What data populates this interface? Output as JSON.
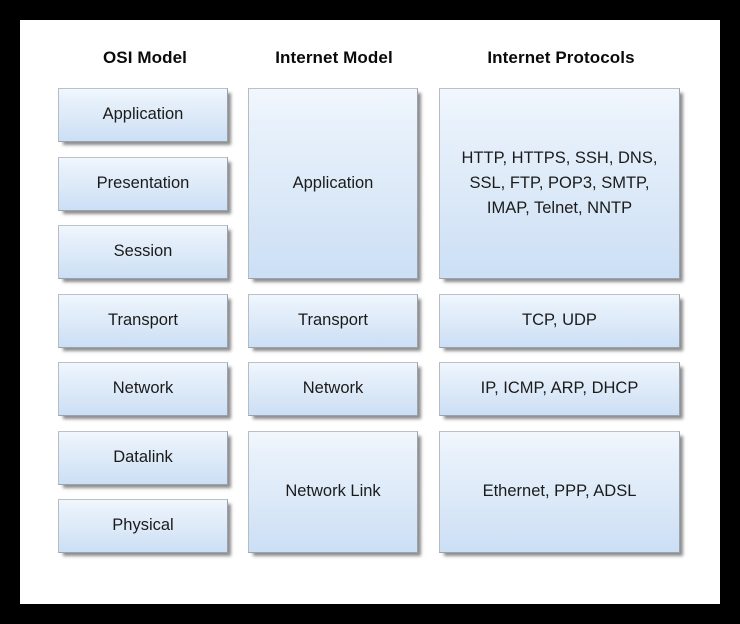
{
  "diagram": {
    "title_row": {
      "osi": "OSI Model",
      "internet": "Internet Model",
      "protocols": "Internet Protocols"
    },
    "columns": [
      {
        "id": "osi-model",
        "header": "OSI Model",
        "boxes": [
          {
            "label": "Application",
            "span": 1
          },
          {
            "label": "Presentation",
            "span": 1
          },
          {
            "label": "Session",
            "span": 1
          },
          {
            "label": "Transport",
            "span": 1
          },
          {
            "label": "Network",
            "span": 1
          },
          {
            "label": "Datalink",
            "span": 1
          },
          {
            "label": "Physical",
            "span": 1
          }
        ]
      },
      {
        "id": "internet-model",
        "header": "Internet Model",
        "boxes": [
          {
            "label": "Application",
            "span": 3
          },
          {
            "label": "Transport",
            "span": 1
          },
          {
            "label": "Network",
            "span": 1
          },
          {
            "label": "Network Link",
            "span": 2
          }
        ]
      },
      {
        "id": "internet-protocols",
        "header": "Internet Protocols",
        "boxes": [
          {
            "label": "HTTP, HTTPS, SSH, DNS,\nSSL, FTP, POP3, SMTP,\nIMAP, Telnet, NNTP",
            "span": 3
          },
          {
            "label": "TCP, UDP",
            "span": 1
          },
          {
            "label": "IP, ICMP, ARP, DHCP",
            "span": 1
          },
          {
            "label": "Ethernet, PPP, ADSL",
            "span": 2
          }
        ]
      }
    ],
    "colors": {
      "frame": "#000000",
      "canvas": "#ffffff",
      "box_fill_top": "#f2f7fd",
      "box_fill_bottom": "#cbdff5",
      "box_border": "#9aa3ad",
      "box_shadow": "#46464",
      "text": "#1b1b1b",
      "header_text": "#0a0a0a"
    }
  }
}
